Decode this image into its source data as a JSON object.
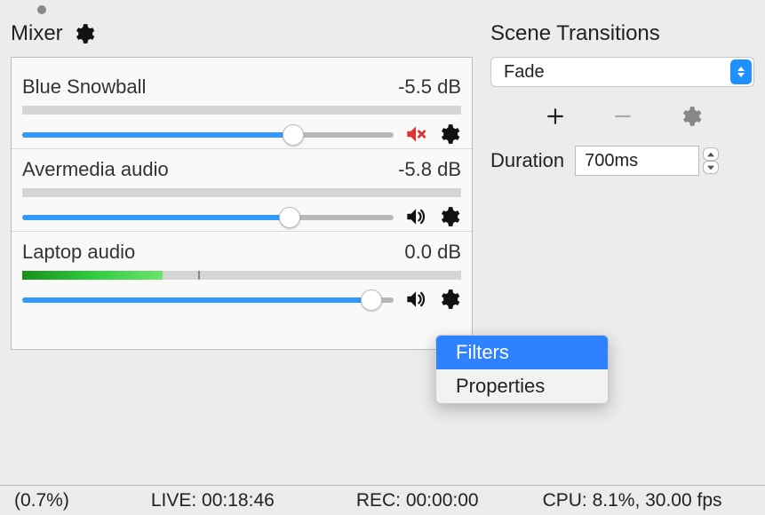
{
  "mixer": {
    "title": "Mixer",
    "channels": [
      {
        "name": "Blue Snowball",
        "db": "-5.5 dB",
        "muted": true,
        "volume_pct": 73,
        "level_pct": 0
      },
      {
        "name": "Avermedia audio",
        "db": "-5.8 dB",
        "muted": false,
        "volume_pct": 72,
        "level_pct": 0
      },
      {
        "name": "Laptop audio",
        "db": "0.0 dB",
        "muted": false,
        "volume_pct": 94,
        "level_pct": 32,
        "level_mark_pct": 40
      }
    ]
  },
  "transitions": {
    "title": "Scene Transitions",
    "selected": "Fade",
    "duration_label": "Duration",
    "duration_value": "700ms"
  },
  "context_menu": {
    "items": [
      {
        "label": "Filters",
        "selected": true
      },
      {
        "label": "Properties",
        "selected": false
      }
    ]
  },
  "status": {
    "drop": "(0.7%)",
    "live": "LIVE: 00:18:46",
    "rec": "REC: 00:00:00",
    "cpu": "CPU: 8.1%, 30.00 fps"
  }
}
